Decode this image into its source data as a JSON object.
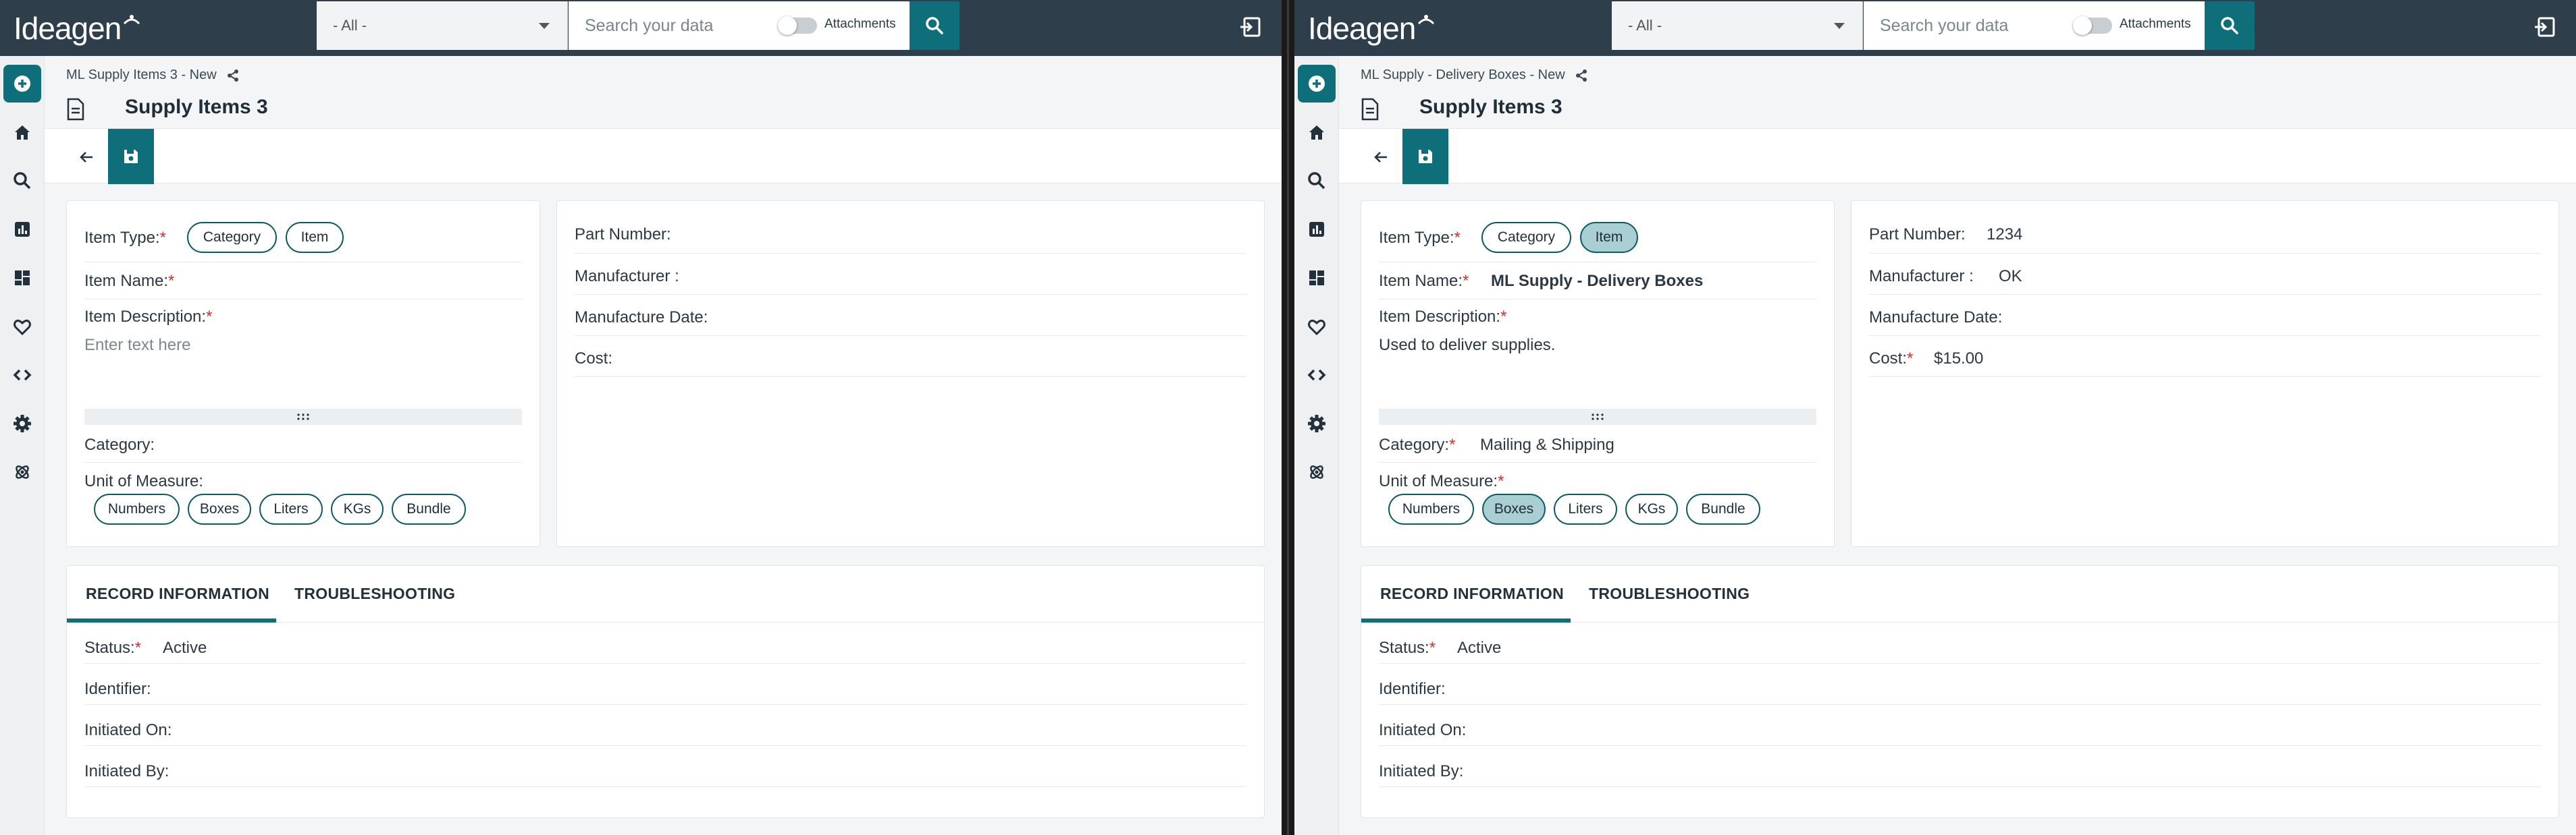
{
  "app": {
    "logo_text": "Ideagen",
    "search_scope": "- All -",
    "search_placeholder": "Search your data",
    "attachments_label": "Attachments"
  },
  "left": {
    "breadcrumb": "ML Supply Items 3 - New",
    "title": "Supply Items 3",
    "fields": {
      "item_type_label": "Item Type:",
      "item_type_options": [
        "Category",
        "Item"
      ],
      "item_type_selected": "",
      "item_name_label": "Item Name:",
      "item_name_value": "",
      "item_description_label": "Item Description:",
      "item_description_value": "",
      "item_description_placeholder": "Enter text here",
      "category_label": "Category:",
      "category_value": "",
      "uom_label": "Unit of Measure:",
      "uom_options": [
        "Numbers",
        "Boxes",
        "Liters",
        "KGs",
        "Bundle"
      ],
      "uom_selected": "",
      "part_number_label": "Part Number:",
      "part_number_value": "",
      "manufacturer_label": "Manufacturer :",
      "manufacturer_value": "",
      "manufacture_date_label": "Manufacture Date:",
      "manufacture_date_value": "",
      "cost_label": "Cost:",
      "cost_value": ""
    },
    "tabs": [
      "RECORD INFORMATION",
      "TROUBLESHOOTING"
    ],
    "record": {
      "status_label": "Status:",
      "status_value": "Active",
      "identifier_label": "Identifier:",
      "identifier_value": "",
      "initiated_on_label": "Initiated On:",
      "initiated_on_value": "",
      "initiated_by_label": "Initiated By:",
      "initiated_by_value": ""
    }
  },
  "right": {
    "breadcrumb": "ML Supply - Delivery Boxes - New",
    "title": "Supply Items 3",
    "fields": {
      "item_type_label": "Item Type:",
      "item_type_options": [
        "Category",
        "Item"
      ],
      "item_type_selected": "Item",
      "item_name_label": "Item Name:",
      "item_name_value": "ML Supply - Delivery Boxes",
      "item_description_label": "Item Description:",
      "item_description_value": "Used to deliver supplies.",
      "item_description_placeholder": "",
      "category_label": "Category:",
      "category_value": "Mailing & Shipping",
      "uom_label": "Unit of Measure:",
      "uom_options": [
        "Numbers",
        "Boxes",
        "Liters",
        "KGs",
        "Bundle"
      ],
      "uom_selected": "Boxes",
      "part_number_label": "Part Number:",
      "part_number_value": "1234",
      "manufacturer_label": "Manufacturer :",
      "manufacturer_value": "OK",
      "manufacture_date_label": "Manufacture Date:",
      "manufacture_date_value": "",
      "cost_label": "Cost:",
      "cost_value": "$15.00"
    },
    "tabs": [
      "RECORD INFORMATION",
      "TROUBLESHOOTING"
    ],
    "record": {
      "status_label": "Status:",
      "status_value": "Active",
      "identifier_label": "Identifier:",
      "identifier_value": "",
      "initiated_on_label": "Initiated On:",
      "initiated_on_value": "",
      "initiated_by_label": "Initiated By:",
      "initiated_by_value": ""
    }
  },
  "colors": {
    "topbar": "#2e3f4b",
    "accent": "#0e6f7a",
    "chip_selected": "#a9cfd2",
    "required": "#d32f2f"
  },
  "icons": {
    "sidebar": [
      "add-icon",
      "home-icon",
      "search-icon",
      "reports-icon",
      "dashboard-icon",
      "favorites-icon",
      "code-icon",
      "settings-icon",
      "integrations-icon"
    ],
    "toolbar": [
      "back-arrow-icon",
      "save-icon"
    ],
    "topbar": [
      "search-icon",
      "exit-icon"
    ]
  }
}
